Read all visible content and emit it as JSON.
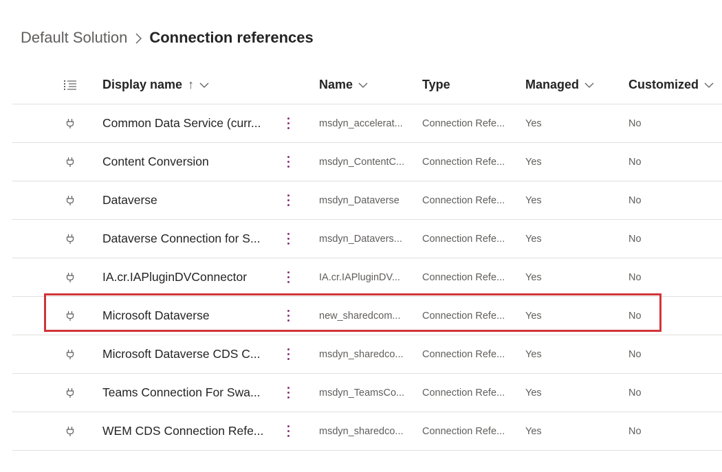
{
  "breadcrumb": {
    "parent": "Default Solution",
    "current": "Connection references"
  },
  "icons": {
    "list": "list-view-icon",
    "connector": "plug-icon",
    "more": "more-vertical-icon",
    "chevron": "chevron-down-icon",
    "separator": "chevron-right-icon"
  },
  "colors": {
    "highlight": "#d13438",
    "more_dots": "#8a2f7a"
  },
  "columns": {
    "display_name": "Display name",
    "sort_indicator": "↑",
    "name": "Name",
    "type": "Type",
    "managed": "Managed",
    "customized": "Customized"
  },
  "rows": [
    {
      "display_name": "Common Data Service (curr...",
      "name": "msdyn_accelerat...",
      "type": "Connection Refe...",
      "managed": "Yes",
      "customized": "No"
    },
    {
      "display_name": "Content Conversion",
      "name": "msdyn_ContentC...",
      "type": "Connection Refe...",
      "managed": "Yes",
      "customized": "No"
    },
    {
      "display_name": "Dataverse",
      "name": "msdyn_Dataverse",
      "type": "Connection Refe...",
      "managed": "Yes",
      "customized": "No"
    },
    {
      "display_name": "Dataverse Connection for S...",
      "name": "msdyn_Datavers...",
      "type": "Connection Refe...",
      "managed": "Yes",
      "customized": "No"
    },
    {
      "display_name": "IA.cr.IAPluginDVConnector",
      "name": "IA.cr.IAPluginDV...",
      "type": "Connection Refe...",
      "managed": "Yes",
      "customized": "No"
    },
    {
      "display_name": "Microsoft Dataverse",
      "name": "new_sharedcom...",
      "type": "Connection Refe...",
      "managed": "Yes",
      "customized": "No"
    },
    {
      "display_name": "Microsoft Dataverse CDS C...",
      "name": "msdyn_sharedco...",
      "type": "Connection Refe...",
      "managed": "Yes",
      "customized": "No"
    },
    {
      "display_name": "Teams Connection For Swa...",
      "name": "msdyn_TeamsCo...",
      "type": "Connection Refe...",
      "managed": "Yes",
      "customized": "No"
    },
    {
      "display_name": "WEM CDS Connection Refe...",
      "name": "msdyn_sharedco...",
      "type": "Connection Refe...",
      "managed": "Yes",
      "customized": "No"
    }
  ]
}
